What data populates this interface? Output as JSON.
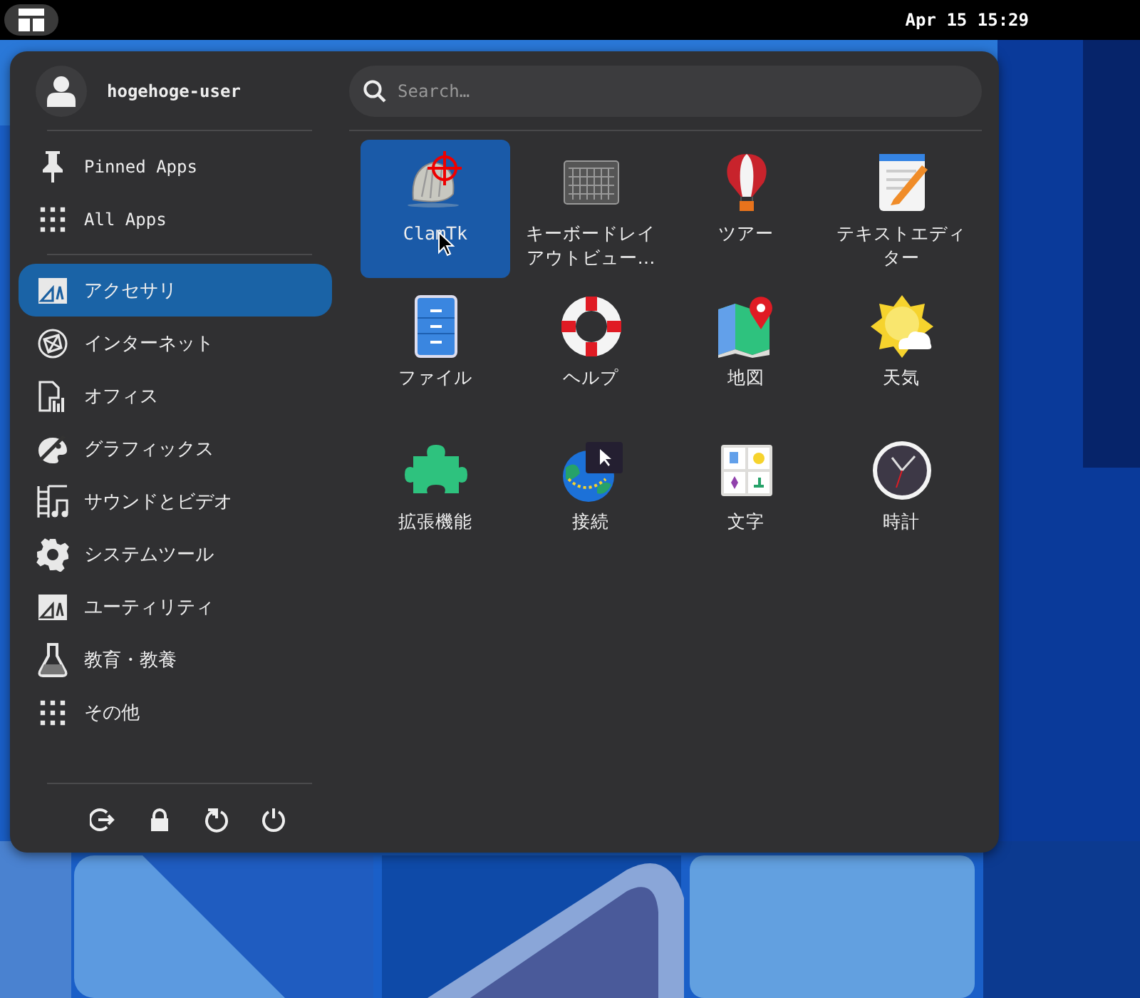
{
  "top_bar": {
    "clock": "Apr 15 15:29"
  },
  "menu": {
    "user": {
      "name": "hogehoge-user"
    },
    "search": {
      "placeholder": "Search…"
    },
    "views": [
      {
        "label": "Pinned Apps",
        "selected": false
      },
      {
        "label": "All Apps",
        "selected": false
      }
    ],
    "categories": [
      {
        "label": "アクセサリ",
        "selected": true
      },
      {
        "label": "インターネット",
        "selected": false
      },
      {
        "label": "オフィス",
        "selected": false
      },
      {
        "label": "グラフィックス",
        "selected": false
      },
      {
        "label": "サウンドとビデオ",
        "selected": false
      },
      {
        "label": "システムツール",
        "selected": false
      },
      {
        "label": "ユーティリティ",
        "selected": false
      },
      {
        "label": "教育・教養",
        "selected": false
      },
      {
        "label": "その他",
        "selected": false
      }
    ],
    "apps": [
      {
        "label": "ClamTk",
        "selected": true
      },
      {
        "label": "キーボードレイアウトビュー…",
        "selected": false
      },
      {
        "label": "ツアー",
        "selected": false
      },
      {
        "label": "テキストエディター",
        "selected": false
      },
      {
        "label": "ファイル",
        "selected": false
      },
      {
        "label": "ヘルプ",
        "selected": false
      },
      {
        "label": "地図",
        "selected": false
      },
      {
        "label": "天気",
        "selected": false
      },
      {
        "label": "拡張機能",
        "selected": false
      },
      {
        "label": "接続",
        "selected": false
      },
      {
        "label": "文字",
        "selected": false
      },
      {
        "label": "時計",
        "selected": false
      }
    ]
  }
}
